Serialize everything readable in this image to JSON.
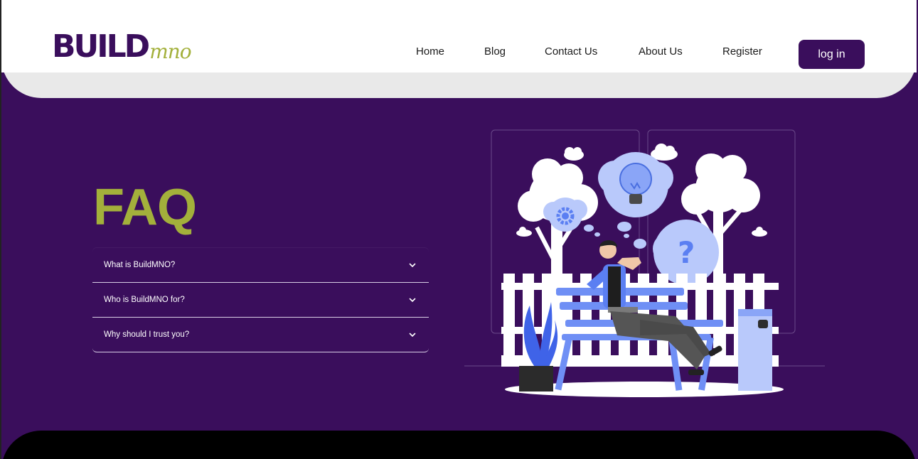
{
  "brand": {
    "logo_main": "BUILD",
    "logo_sub": "mno"
  },
  "nav": {
    "items": [
      "Home",
      "Blog",
      "Contact Us",
      "About Us",
      "Register"
    ],
    "login_label": "log in"
  },
  "faq": {
    "title": "FAQ",
    "questions": [
      {
        "question": "What is BuildMNO?"
      },
      {
        "question": "Who is BuildMNO for?"
      },
      {
        "question": "Why should I trust you?"
      }
    ]
  },
  "colors": {
    "brand_purple": "#3a0e5c",
    "accent_olive": "#a3b03b",
    "illustration_blue": "#5b7ff2",
    "light_gray": "#e9e9e9"
  },
  "icons": {
    "accordion": "chevron-down-icon",
    "illustration": "thinking-man-on-bench-illustration"
  }
}
